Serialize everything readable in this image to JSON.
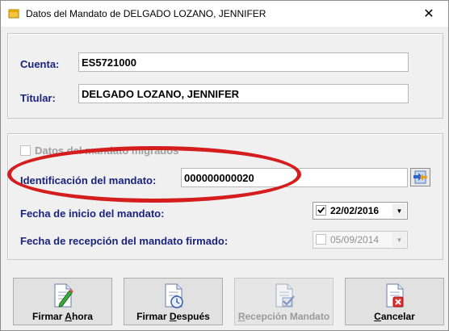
{
  "window": {
    "title": "Datos del Mandato de DELGADO LOZANO, JENNIFER",
    "close_glyph": "✕"
  },
  "account": {
    "cuenta_label": "Cuenta:",
    "cuenta_value": "ES5721000",
    "titular_label": "Titular:",
    "titular_value": "DELGADO LOZANO, JENNIFER"
  },
  "mandate": {
    "migrated_label": "Datos del mandato migrados",
    "identification_label": "Identificación del mandato:",
    "identification_value": "000000000020",
    "start_date_label": "Fecha de inicio del mandato:",
    "start_date_checked": true,
    "start_date_value": "22/02/2016",
    "signed_date_label": "Fecha de recepción del mandato firmado:",
    "signed_date_checked": false,
    "signed_date_value": "05/09/2014"
  },
  "buttons": [
    {
      "prefix": "Firmar ",
      "accel": "A",
      "suffix": "hora",
      "enabled": true,
      "icon": "sign-pencil-icon"
    },
    {
      "prefix": "Firmar ",
      "accel": "D",
      "suffix": "espués",
      "enabled": true,
      "icon": "sign-later-clock-icon"
    },
    {
      "prefix": "",
      "accel": "R",
      "suffix": "ecepción Mandato",
      "enabled": false,
      "icon": "document-check-icon"
    },
    {
      "prefix": "",
      "accel": "C",
      "suffix": "ancelar",
      "enabled": true,
      "icon": "document-cancel-icon"
    }
  ],
  "colors": {
    "label_blue": "#1a237e",
    "annotation_red": "#d41d1d"
  }
}
